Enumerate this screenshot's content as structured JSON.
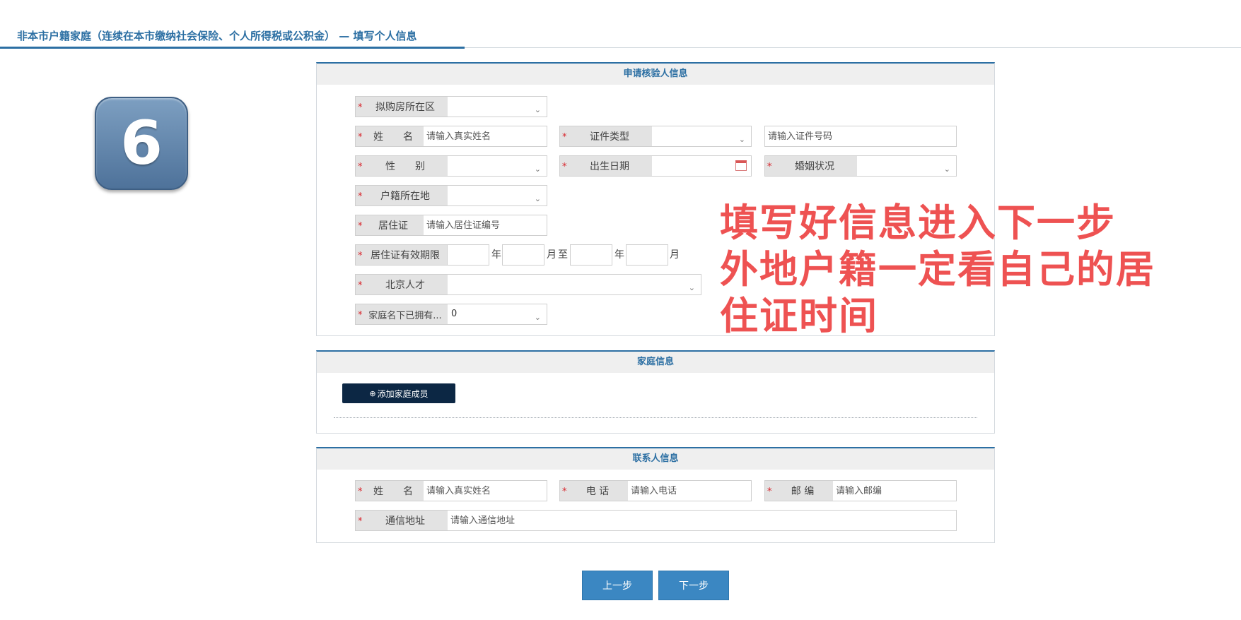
{
  "header": {
    "title": "非本市户籍家庭（连续在本市缴纳社会保险、个人所得税或公积金） — 填写个人信息"
  },
  "step": {
    "number": "6"
  },
  "applicant": {
    "section_title": "申请核验人信息",
    "district_label": "拟购房所在区",
    "name_label": "姓　　名",
    "name_placeholder": "请输入真实姓名",
    "id_type_label": "证件类型",
    "id_number_placeholder": "请输入证件号码",
    "gender_label": "性　　别",
    "birth_label": "出生日期",
    "marital_label": "婚姻状况",
    "hukou_label": "户籍所在地",
    "residence_label": "居住证",
    "residence_placeholder": "请输入居住证编号",
    "validity_label": "居住证有效期限",
    "year_unit": "年",
    "month_unit": "月",
    "to_text": "至",
    "talent_label": "北京人才",
    "owned_label": "家庭名下已拥有...",
    "owned_value": "0"
  },
  "family": {
    "section_title": "家庭信息",
    "add_member_label": "添加家庭成员"
  },
  "contact": {
    "section_title": "联系人信息",
    "name_label": "姓　　名",
    "name_placeholder": "请输入真实姓名",
    "phone_label": "电 话",
    "phone_placeholder": "请输入电话",
    "zip_label": "邮 编",
    "zip_placeholder": "请输入邮编",
    "address_label": "通信地址",
    "address_placeholder": "请输入通信地址"
  },
  "nav": {
    "prev_label": "上一步",
    "next_label": "下一步"
  },
  "annotation": {
    "line1": "填写好信息进入下一步",
    "line2": "外地户籍一定看自己的居",
    "line3": "住证时间"
  },
  "colors": {
    "accent": "#2c6fa3",
    "button": "#3b87c2",
    "required": "#d8262c",
    "annotation": "#ee5252",
    "dark_button": "#0c2744"
  },
  "icons": {
    "select": "chevron-down-icon",
    "date": "calendar-icon",
    "add": "plus-circle-icon",
    "step": "number-badge"
  }
}
